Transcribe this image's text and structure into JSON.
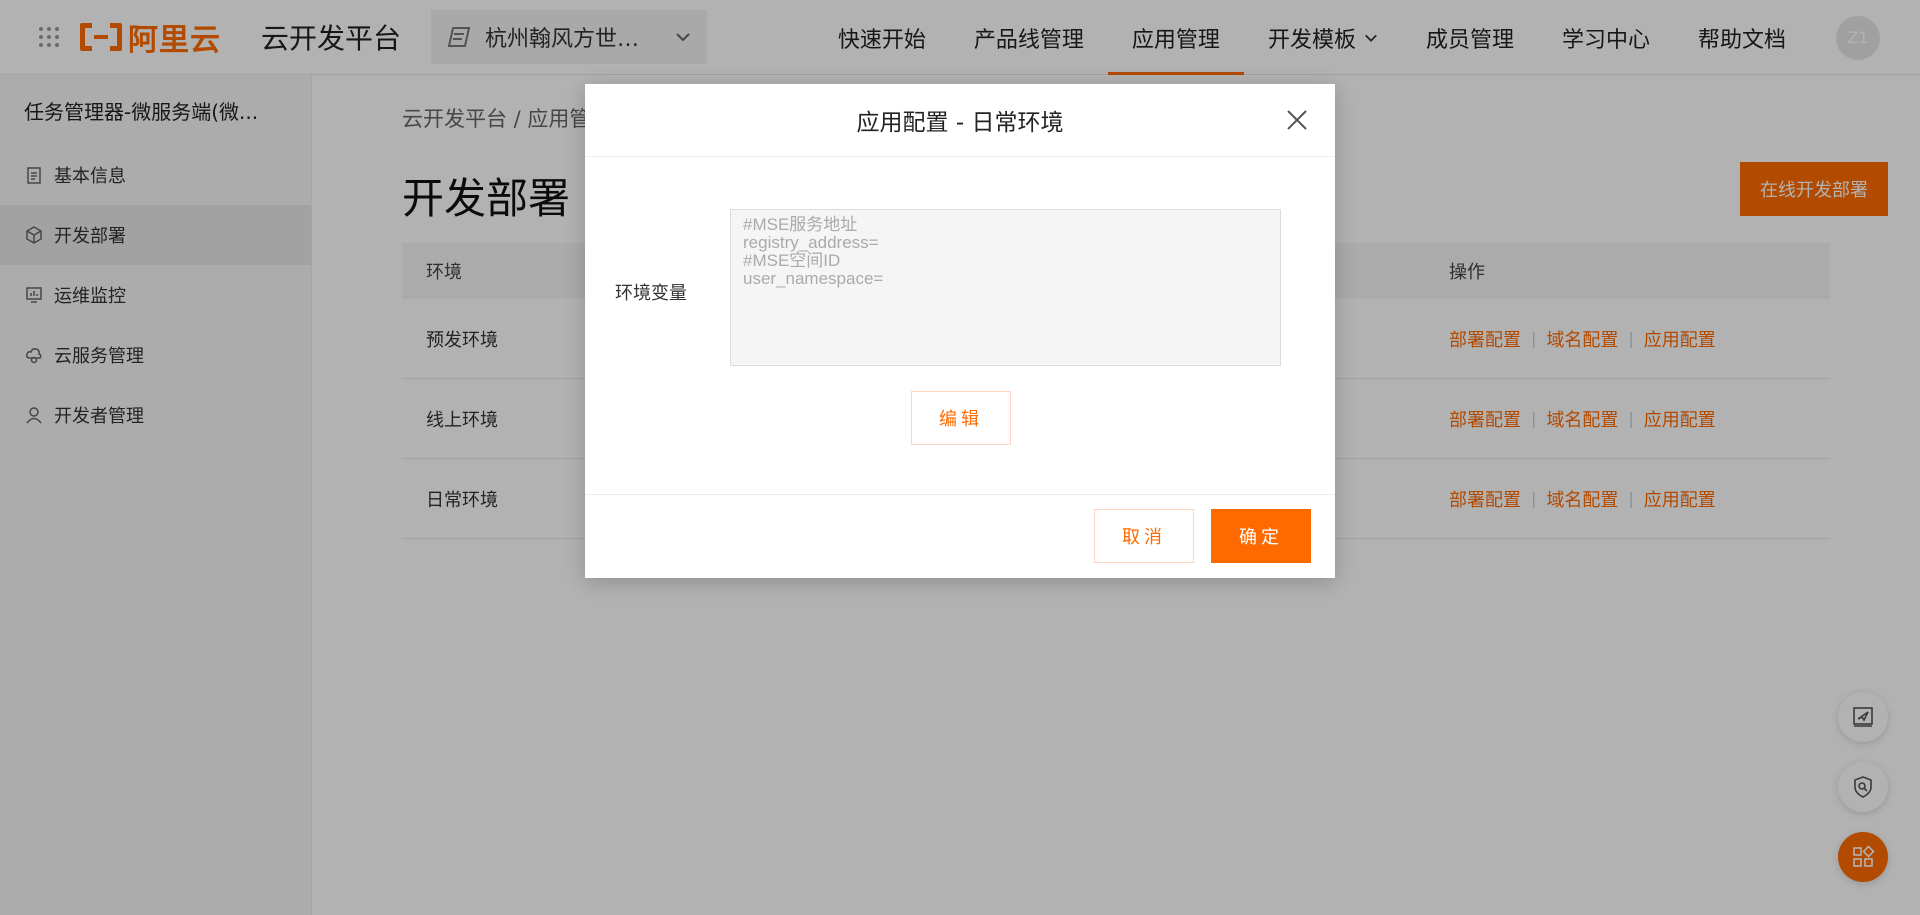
{
  "header": {
    "logo_text": "阿里云",
    "platform_name": "云开发平台",
    "org": "杭州翰风方世…",
    "nav": [
      {
        "label": "快速开始"
      },
      {
        "label": "产品线管理"
      },
      {
        "label": "应用管理"
      },
      {
        "label": "开发模板"
      },
      {
        "label": "成员管理"
      },
      {
        "label": "学习中心"
      },
      {
        "label": "帮助文档"
      }
    ],
    "active_nav": "应用管理",
    "avatar_text": "Z1"
  },
  "sidebar": {
    "title": "任务管理器-微服务端(微...",
    "items": [
      {
        "label": "基本信息",
        "icon": "clipboard-icon"
      },
      {
        "label": "开发部署",
        "icon": "cube-icon"
      },
      {
        "label": "运维监控",
        "icon": "monitor-icon"
      },
      {
        "label": "云服务管理",
        "icon": "cloud-icon"
      },
      {
        "label": "开发者管理",
        "icon": "user-icon"
      }
    ],
    "active": "开发部署"
  },
  "main": {
    "breadcrumb": "云开发平台 / 应用管",
    "title": "开发部署",
    "online_deploy_btn": "在线开发部署",
    "table": {
      "headers": {
        "env": "环境",
        "op": "操作"
      },
      "rows": [
        {
          "env": "预发环境",
          "ops": [
            "部署配置",
            "域名配置",
            "应用配置"
          ]
        },
        {
          "env": "线上环境",
          "ops": [
            "部署配置",
            "域名配置",
            "应用配置"
          ]
        },
        {
          "env": "日常环境",
          "ops": [
            "部署配置",
            "域名配置",
            "应用配置"
          ]
        }
      ]
    }
  },
  "modal": {
    "title": "应用配置 - 日常环境",
    "env_label": "环境变量",
    "env_value": "#MSE服务地址\nregistry_address=\n#MSE空间ID\nuser_namespace=",
    "edit_btn": "编辑",
    "cancel_btn": "取消",
    "ok_btn": "确定"
  },
  "colors": {
    "accent": "#ff6a00"
  }
}
